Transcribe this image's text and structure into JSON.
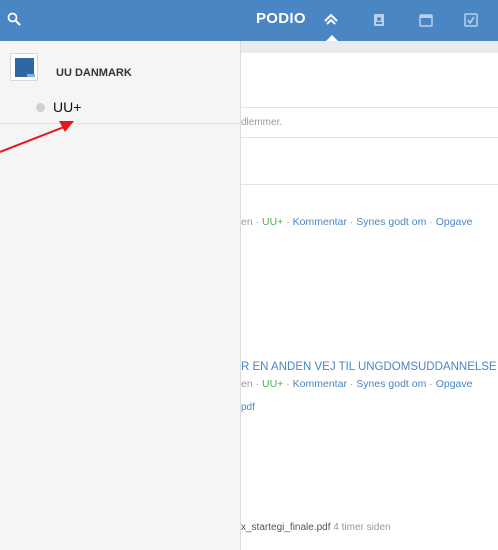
{
  "topbar": {
    "logo": "PODIO",
    "icons": [
      "search-icon",
      "home-icon",
      "contacts-icon",
      "calendar-icon",
      "tasks-icon"
    ],
    "background": "#4a86c3"
  },
  "drawer": {
    "organization": "UU DANMARK",
    "spaces": [
      {
        "label": "UU+"
      }
    ]
  },
  "main": {
    "members_fragment": "dlemmer.",
    "post1": {
      "prefix": "en · ",
      "space": "UU+",
      "actions": [
        "Kommentar",
        "Synes godt om",
        "Opgave"
      ]
    },
    "post2": {
      "title_fragment": "R EN ANDEN VEJ TIL UNGDOMSUDDANNELSE",
      "prefix": "en · ",
      "space": "UU+",
      "actions": [
        "Kommentar",
        "Synes godt om",
        "Opgave"
      ],
      "attachment_fragment": "pdf"
    },
    "file": {
      "name": "x_startegi_finale.pdf",
      "time": "4 timer siden"
    }
  },
  "annotation": {
    "color": "#e8141b"
  }
}
